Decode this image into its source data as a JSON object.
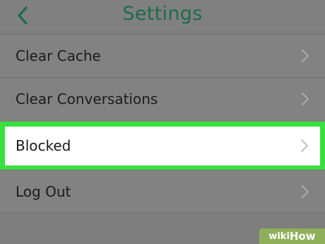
{
  "header": {
    "title": "Settings",
    "back_icon": "chevron-left-icon"
  },
  "settings": {
    "items": [
      {
        "label": "Clear Cache",
        "icon": "chevron-right-icon"
      },
      {
        "label": "Clear Conversations",
        "icon": "chevron-right-icon"
      },
      {
        "label": "Blocked",
        "icon": "chevron-right-icon",
        "highlighted": true
      },
      {
        "label": "Log Out",
        "icon": "chevron-right-icon"
      }
    ]
  },
  "watermark": {
    "wiki": "wiki",
    "how": "How"
  },
  "colors": {
    "title": "#1f6b4e",
    "highlight_border": "#38e03d",
    "background": "#7e7e7e",
    "chevron": "#a9a9a9"
  }
}
